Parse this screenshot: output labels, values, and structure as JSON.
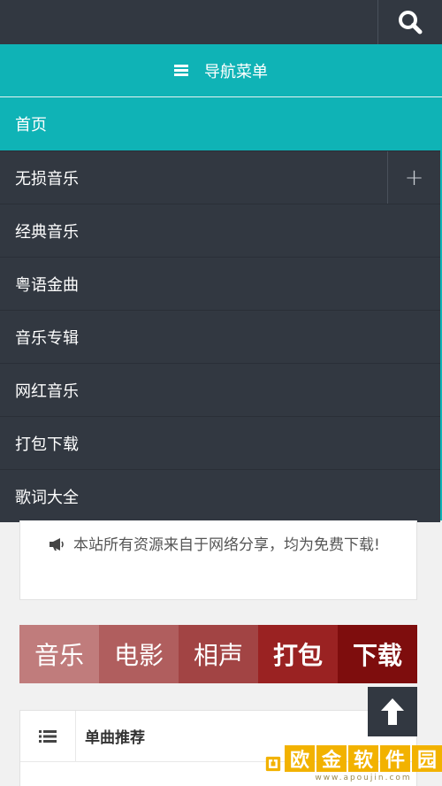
{
  "nav": {
    "title": "导航菜单",
    "items": [
      {
        "label": "首页",
        "active": true
      },
      {
        "label": "无损音乐",
        "expandable": true,
        "expand_symbol": "+"
      },
      {
        "label": "经典音乐"
      },
      {
        "label": "粤语金曲"
      },
      {
        "label": "音乐专辑"
      },
      {
        "label": "网红音乐"
      },
      {
        "label": "打包下载"
      },
      {
        "label": "歌词大全"
      }
    ]
  },
  "notice": {
    "text": "本站所有资源来自于网络分享，均为免费下载!"
  },
  "tiles": [
    {
      "label": "音乐",
      "color": "#c07c7c"
    },
    {
      "label": "电影",
      "color": "#b05e5e"
    },
    {
      "label": "相声",
      "color": "#a24444"
    },
    {
      "label": "打包",
      "color": "#9a2222"
    },
    {
      "label": "下载",
      "color": "#7e0d0d"
    }
  ],
  "panel": {
    "title": "单曲推荐"
  },
  "watermark": {
    "chars": [
      "欧",
      "金",
      "软",
      "件",
      "园"
    ],
    "url": "www.apoujin.com"
  },
  "colors": {
    "topbar": "#323841",
    "accent": "#0fb3b6",
    "logo": "#f2b200"
  },
  "icons": [
    "search-icon",
    "menu-icon",
    "plus-icon",
    "megaphone-icon",
    "list-icon",
    "arrow-up-icon"
  ]
}
